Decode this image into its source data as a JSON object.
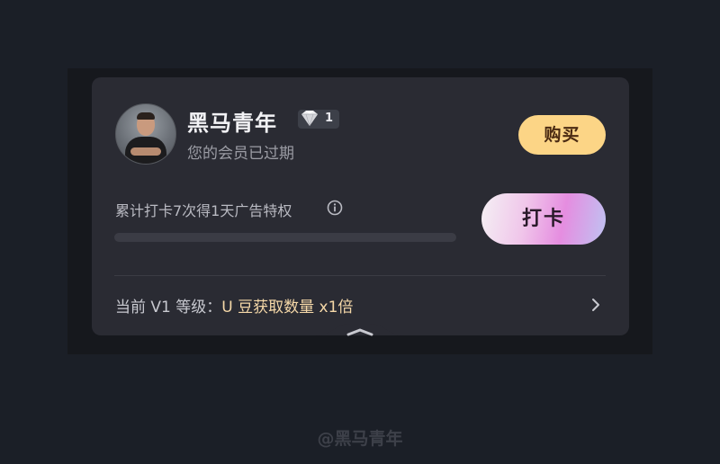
{
  "profile": {
    "avatar_icon": "user-avatar-photo",
    "name": "黑马青年",
    "level_icon": "diamond-icon",
    "level_number": "1",
    "status": "您的会员已过期"
  },
  "buy_button": {
    "label": "购买",
    "color": "#fcd586"
  },
  "checkin": {
    "description": "累计打卡7次得1天广告特权",
    "info_icon": "info-icon",
    "progress_fraction": 0,
    "button_label": "打卡"
  },
  "level_benefit": {
    "label": "当前 V1 等级：",
    "benefit": "U 豆获取数量 x1倍",
    "chevron_icon": "chevron-right-icon"
  },
  "collapse_handle_icon": "chevron-up-icon",
  "watermark": "@黑马青年"
}
